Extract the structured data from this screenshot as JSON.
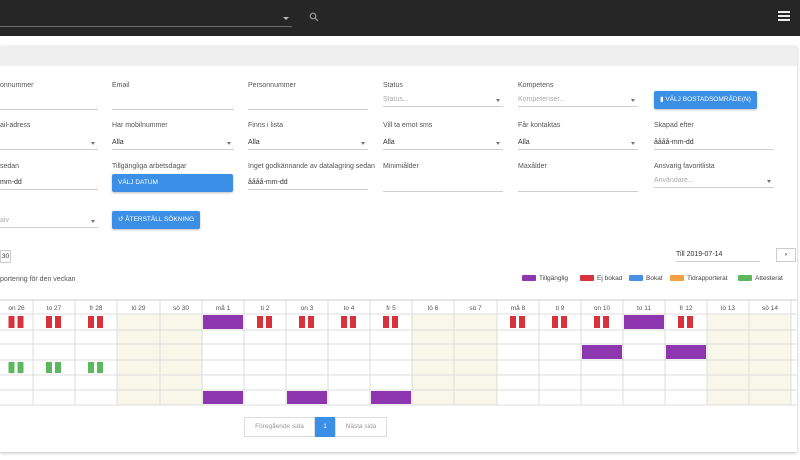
{
  "topbar": {
    "menu_icon": "hamburger-menu-icon",
    "search_icon": "search-icon"
  },
  "filters": {
    "personnummer_label_left": "onnummer",
    "email_label": "Email",
    "personnummer_label": "Personnummer",
    "status_label": "Status",
    "status_placeholder": "Status...",
    "kompetens_label": "Kompetens",
    "kompetens_placeholder": "Kompetenser...",
    "bostad_button": "VÄLJ BOSTADSOMRÅDE(N)",
    "mailadress_label": "ail-adress",
    "har_mobil_label": "Har mobilnummer",
    "har_mobil_value": "Alla",
    "finns_lista_label": "Finns i lista",
    "finns_lista_value": "Alla",
    "sms_label": "Vill ta emot sms",
    "sms_value": "Alla",
    "kontaktas_label": "Får kontaktas",
    "kontaktas_value": "Alla",
    "skapad_label": "Skapad efter",
    "skapad_value": "åååå-mm-dd",
    "sedan_label": "sedan",
    "sedan_value": "mm-dd",
    "arbetsdagar_label": "Tillgängliga arbetsdagar",
    "valj_datum_button": "VÄLJ DATUM",
    "godkannande_label": "Inget godkännande av datalagring sedan",
    "godkannande_value": "åååå-mm-dd",
    "minalder_label": "Minimiålder",
    "maxalder_label": "Maxålder",
    "ansvarig_label": "Ansvarig favoritlista",
    "ansvarig_placeholder": "Användare...",
    "left_select_value": "aiv",
    "reset_button": "ÅTERSTÄLL SÖKNING"
  },
  "calendar": {
    "from_value": "30",
    "till_value": "Till 2019-07-14",
    "next_label": "›",
    "caption": "portering för den veckan",
    "legend": [
      {
        "label": "Tillgänglig",
        "color": "#8e35b0"
      },
      {
        "label": "Ej bokad",
        "color": "#d8323c"
      },
      {
        "label": "Bokat",
        "color": "#4a90e2"
      },
      {
        "label": "Tidrapporterat",
        "color": "#f0a040"
      },
      {
        "label": "Attesterat",
        "color": "#5cb85c"
      }
    ],
    "days": [
      "on 26",
      "to 27",
      "fr 28",
      "lö 29",
      "sö 30",
      "må 1",
      "ti 2",
      "on 3",
      "to 4",
      "fr 5",
      "lö 6",
      "sö 7",
      "må 8",
      "ti 9",
      "on 10",
      "to 11",
      "fr 12",
      "lö 13",
      "sö 14"
    ],
    "weekend": [
      false,
      false,
      false,
      true,
      true,
      false,
      false,
      false,
      false,
      false,
      true,
      true,
      false,
      false,
      false,
      false,
      false,
      true,
      true
    ],
    "rows": [
      [
        "r",
        "r",
        "r",
        "",
        "",
        "P",
        "r",
        "r",
        "r",
        "r",
        "",
        "",
        "r",
        "r",
        "r",
        "P",
        "r",
        "",
        ""
      ],
      [
        "",
        "",
        "",
        "",
        "",
        "",
        "",
        "",
        "",
        "",
        "",
        "",
        "",
        "",
        "",
        "",
        "",
        "",
        ""
      ],
      [
        "",
        "",
        "",
        "",
        "",
        "",
        "",
        "",
        "",
        "",
        "",
        "",
        "",
        "",
        "P",
        "",
        "P",
        "",
        ""
      ],
      [
        "g",
        "g",
        "g",
        "",
        "",
        "",
        "",
        "",
        "",
        "",
        "",
        "",
        "",
        "",
        "",
        "",
        "",
        "",
        ""
      ],
      [
        "",
        "",
        "",
        "",
        "",
        "",
        "",
        "",
        "",
        "",
        "",
        "",
        "",
        "",
        "",
        "",
        "",
        "",
        ""
      ],
      [
        "",
        "",
        "",
        "",
        "",
        "P",
        "",
        "P",
        "",
        "P",
        "",
        "",
        "",
        "",
        "",
        "",
        "",
        "",
        ""
      ]
    ]
  },
  "pagination": {
    "prev": "Föregående sida",
    "current": "1",
    "next": "Nästa sida"
  },
  "colors": {
    "accent": "#3b8fe6",
    "available": "#8e35b0",
    "not_booked": "#d8323c",
    "attested": "#5cb85c",
    "weekend": "#f9f7ea"
  }
}
